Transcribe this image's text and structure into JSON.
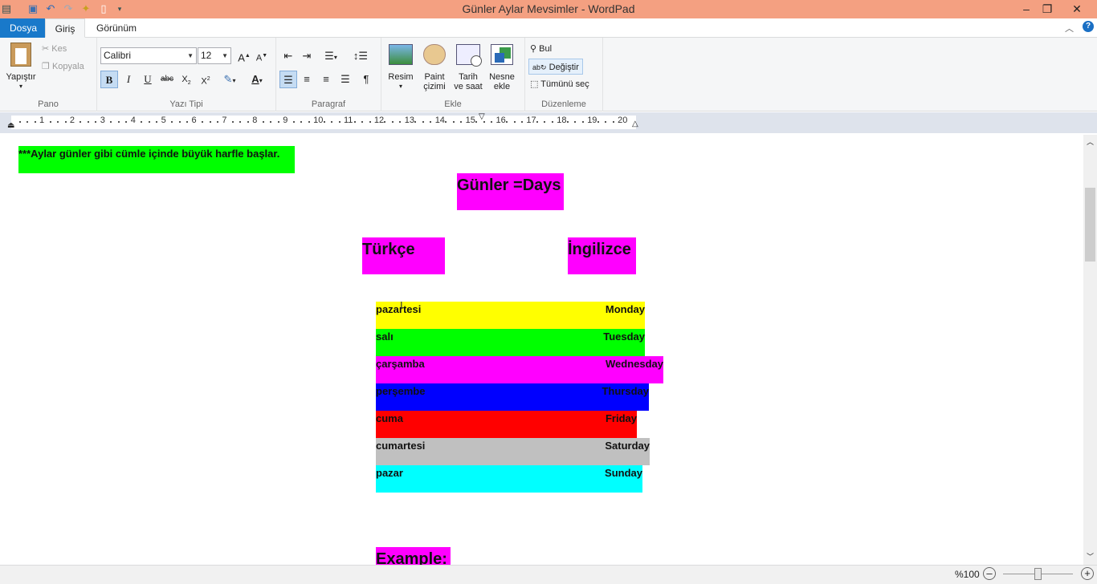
{
  "window": {
    "title": "Günler Aylar Mevsimler - WordPad"
  },
  "tabs": {
    "file": "Dosya",
    "home": "Giriş",
    "view": "Görünüm"
  },
  "ribbon": {
    "clipboard": {
      "label": "Pano",
      "paste": "Yapıştır",
      "cut": "Kes",
      "copy": "Kopyala"
    },
    "font": {
      "label": "Yazı Tipi",
      "family": "Calibri",
      "size": "12"
    },
    "paragraph": {
      "label": "Paragraf"
    },
    "insert": {
      "label": "Ekle",
      "picture": "Resim",
      "paint1": "Paint",
      "paint2": "çizimi",
      "dt1": "Tarih",
      "dt2": "ve saat",
      "obj1": "Nesne",
      "obj2": "ekle"
    },
    "editing": {
      "label": "Düzenleme",
      "find": "Bul",
      "replace": "Değiştir",
      "select_all": "Tümünü seç"
    }
  },
  "ruler": {
    "numbers": [
      "1",
      "2",
      "3",
      "4",
      "5",
      "6",
      "7",
      "8",
      "9",
      "10",
      "11",
      "12",
      "13",
      "14",
      "15",
      "16",
      "17",
      "18",
      "19",
      "20"
    ]
  },
  "document": {
    "note": "***Aylar günler gibi cümle içinde büyük harfle başlar.",
    "heading": "Günler =Days",
    "col_tr": "Türkçe",
    "col_en": "İngilizce",
    "rows": [
      {
        "tr": "pazartesi",
        "en": "Monday",
        "color": "#ffff00"
      },
      {
        "tr": "salı",
        "en": "Tuesday",
        "color": "#00ff00"
      },
      {
        "tr": "çarşamba",
        "en": "Wednesday",
        "color": "#ff00ff"
      },
      {
        "tr": "perşembe",
        "en": "Thursday",
        "color": "#0000ff"
      },
      {
        "tr": "cuma",
        "en": "Friday",
        "color": "#ff0000"
      },
      {
        "tr": "cumartesi",
        "en": "Saturday",
        "color": "#c0c0c0"
      },
      {
        "tr": "pazar",
        "en": "Sunday",
        "color": "#00ffff"
      }
    ],
    "example": "Example:"
  },
  "status": {
    "zoom": "%100"
  },
  "colors": {
    "titlebar": "#f4a081",
    "file_tab": "#1979ca",
    "magenta": "#ff00ff",
    "green": "#00ff00"
  }
}
